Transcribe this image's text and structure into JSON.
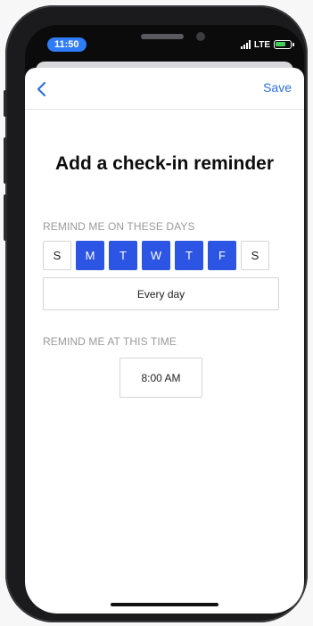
{
  "status_bar": {
    "time": "11:50",
    "network": "LTE"
  },
  "nav": {
    "save_label": "Save"
  },
  "title": "Add a check-in reminder",
  "days_section": {
    "label": "REMIND ME ON THESE DAYS",
    "days": [
      {
        "label": "S",
        "selected": false
      },
      {
        "label": "M",
        "selected": true
      },
      {
        "label": "T",
        "selected": true
      },
      {
        "label": "W",
        "selected": true
      },
      {
        "label": "T",
        "selected": true
      },
      {
        "label": "F",
        "selected": true
      },
      {
        "label": "S",
        "selected": false
      }
    ],
    "every_day_label": "Every day"
  },
  "time_section": {
    "label": "REMIND ME AT THIS TIME",
    "time_value": "8:00 AM"
  },
  "colors": {
    "accent": "#2c55e3",
    "link": "#2f6fe4",
    "status_pill": "#2e7cf6"
  }
}
